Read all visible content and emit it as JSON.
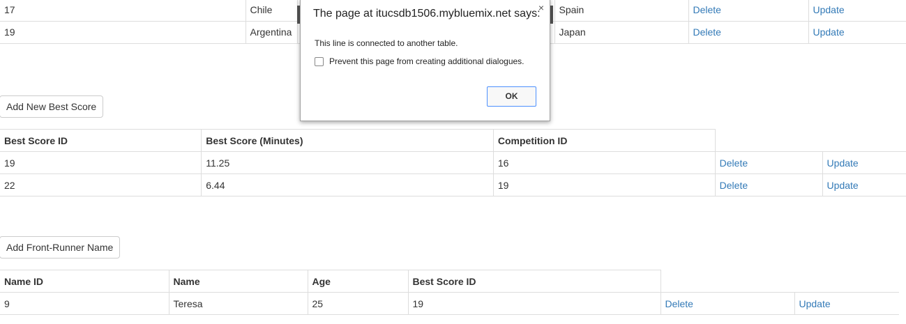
{
  "countries_table": {
    "rows": [
      {
        "id": "17",
        "country_a": "Chile",
        "country_b": "Spain",
        "delete": "Delete",
        "update": "Update"
      },
      {
        "id": "19",
        "country_a": "Argentina",
        "country_b": "Japan",
        "delete": "Delete",
        "update": "Update"
      }
    ]
  },
  "best_score": {
    "add_button": "Add New Best Score",
    "headers": [
      "Best Score ID",
      "Best Score (Minutes)",
      "Competition ID"
    ],
    "rows": [
      {
        "id": "19",
        "score": "11.25",
        "competition_id": "16",
        "delete": "Delete",
        "update": "Update"
      },
      {
        "id": "22",
        "score": "6.44",
        "competition_id": "19",
        "delete": "Delete",
        "update": "Update"
      }
    ]
  },
  "front_runner": {
    "add_button": "Add Front-Runner Name",
    "headers": [
      "Name ID",
      "Name",
      "Age",
      "Best Score ID"
    ],
    "rows": [
      {
        "id": "9",
        "name": "Teresa",
        "age": "25",
        "best_score_id": "19",
        "delete": "Delete",
        "update": "Update"
      }
    ]
  },
  "dialog": {
    "title": "The page at itucsdb1506.mybluemix.net says:",
    "message": "This line is connected to another table.",
    "checkbox_label": "Prevent this page from creating additional dialogues.",
    "checkbox_checked": false,
    "ok_label": "OK",
    "close_glyph": "×"
  },
  "colors": {
    "link": "#337ab7",
    "border": "#dddddd",
    "focus": "#4d90fe"
  }
}
